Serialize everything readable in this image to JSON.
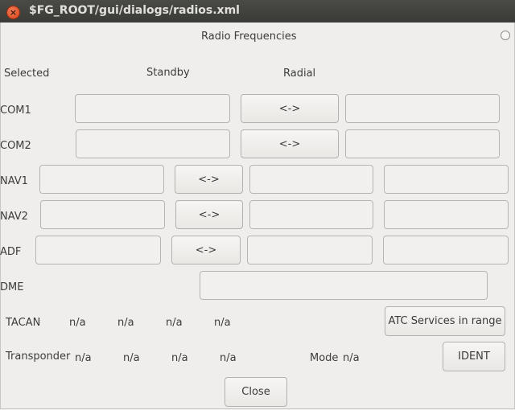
{
  "window": {
    "title": "$FG_ROOT/gui/dialogs/radios.xml"
  },
  "dialog": {
    "title": "Radio Frequencies",
    "headers": {
      "selected": "Selected",
      "standby": "Standby",
      "radial": "Radial"
    },
    "rows": {
      "com1": {
        "label": "COM1",
        "swap": "<->"
      },
      "com2": {
        "label": "COM2",
        "swap": "<->"
      },
      "nav1": {
        "label": "NAV1",
        "swap": "<->"
      },
      "nav2": {
        "label": "NAV2",
        "swap": "<->"
      },
      "adf": {
        "label": "ADF",
        "swap": "<->"
      },
      "dme": {
        "label": "DME"
      }
    },
    "tacan": {
      "label": "TACAN",
      "values": [
        "n/a",
        "n/a",
        "n/a",
        "n/a"
      ]
    },
    "atc_button": "ATC Services in range",
    "transponder": {
      "label": "Transponder",
      "values": [
        "n/a",
        "n/a",
        "n/a",
        "n/a"
      ],
      "mode_label": "Mode",
      "mode_value": "n/a"
    },
    "ident_button": "IDENT",
    "close_button": "Close"
  }
}
